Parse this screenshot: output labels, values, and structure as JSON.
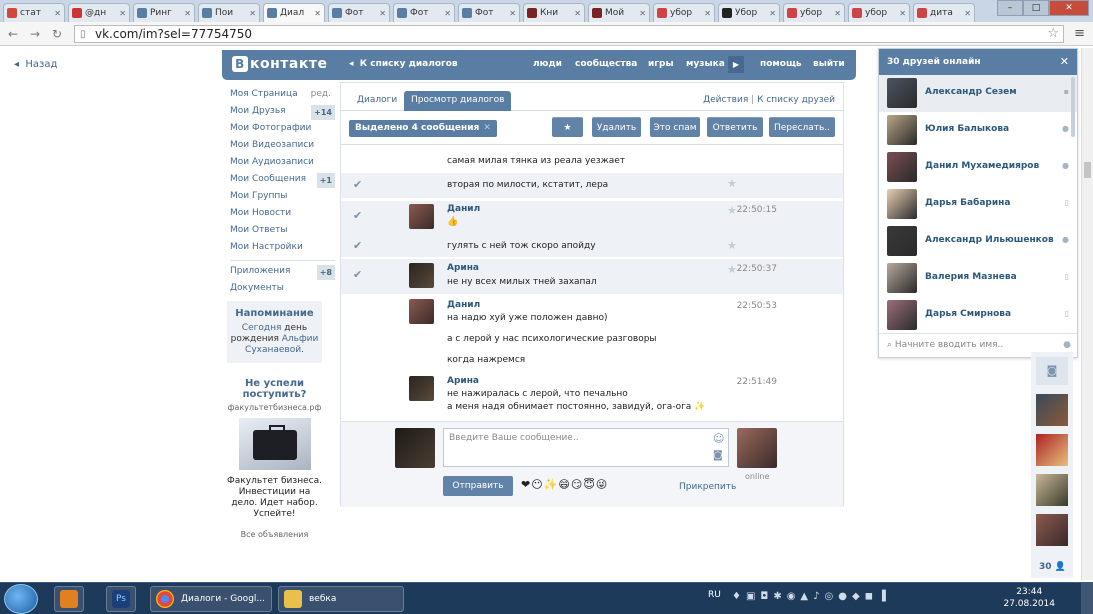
{
  "browser": {
    "tabs": [
      {
        "title": "стат",
        "icon_color": "#d04a3a"
      },
      {
        "title": "@дн",
        "icon_color": "#c33"
      },
      {
        "title": "Ринг",
        "icon_color": "#597da3"
      },
      {
        "title": "Пои",
        "icon_color": "#597da3"
      },
      {
        "title": "Диал",
        "icon_color": "#597da3",
        "active": true
      },
      {
        "title": "Фот",
        "icon_color": "#597da3"
      },
      {
        "title": "Фот",
        "icon_color": "#597da3"
      },
      {
        "title": "Фот",
        "icon_color": "#597da3"
      },
      {
        "title": "Кни",
        "icon_color": "#7a2323"
      },
      {
        "title": "Мой",
        "icon_color": "#7a2323"
      },
      {
        "title": "убор",
        "icon_color": "#c44"
      },
      {
        "title": "Убор",
        "icon_color": "#222"
      },
      {
        "title": "убор",
        "icon_color": "#c44"
      },
      {
        "title": "убор",
        "icon_color": "#c44"
      },
      {
        "title": "дита",
        "icon_color": "#c44"
      }
    ],
    "url": "vk.com/im?sel=77754750"
  },
  "back_label": "Назад",
  "header": {
    "logo": "контакте",
    "logo_letter": "В",
    "to_list": "К списку диалогов",
    "nav": [
      "люди",
      "сообщества",
      "игры",
      "музыка",
      "помощь",
      "выйти"
    ]
  },
  "left_menu": {
    "items": [
      {
        "label": "Моя Страница",
        "extra": "ред."
      },
      {
        "label": "Мои Друзья",
        "badge": "+14"
      },
      {
        "label": "Мои Фотографии"
      },
      {
        "label": "Мои Видеозаписи"
      },
      {
        "label": "Мои Аудиозаписи"
      },
      {
        "label": "Мои Сообщения",
        "badge": "+1"
      },
      {
        "label": "Мои Группы"
      },
      {
        "label": "Мои Новости"
      },
      {
        "label": "Мои Ответы"
      },
      {
        "label": "Мои Настройки"
      }
    ],
    "items2": [
      {
        "label": "Приложения",
        "badge": "+8"
      },
      {
        "label": "Документы"
      }
    ]
  },
  "reminder": {
    "title": "Напоминание",
    "text1": "Сегодня",
    "text2": "день рождения",
    "name": "Альфии Суханаевой",
    "dot": "."
  },
  "ad": {
    "title": "Не успели поступить?",
    "domain": "факультетбизнеса.рф",
    "text": "Факультет бизнеса. Инвестиции на дело. Идет набор. Успейте!",
    "all": "Все объявления"
  },
  "dialog": {
    "tabs": [
      "Диалоги",
      "Просмотр диалогов"
    ],
    "right_actions": "Действия",
    "right_sep": "|",
    "right_list": "К списку друзей",
    "selected": "Выделено 4 сообщения",
    "buttons": [
      "★",
      "Удалить",
      "Это спам",
      "Ответить",
      "Переслать.."
    ],
    "messages": [
      {
        "text": "самая милая тянка из реала уезжает"
      },
      {
        "text": "вторая по милости, кстатит, лера"
      },
      {
        "name": "Данил",
        "time": "22:50:15",
        "text": "👍"
      },
      {
        "text": "гулять с ней тож скоро апойду"
      },
      {
        "name": "Арина",
        "time": "22:50:37",
        "text": "не ну всех милых тней захапал"
      },
      {
        "name": "Данил",
        "time": "22:50:53",
        "text": "на надю хуй уже положен давно)"
      },
      {
        "text": "а с лерой у нас психологические разговоры"
      },
      {
        "text": "когда нажремся"
      },
      {
        "name": "Арина",
        "time": "22:51:49",
        "text": "не нажиралась с лерой, что печально"
      },
      {
        "text": "а меня надя обнимает постоянно, завидуй, ога-ога ✨"
      }
    ],
    "input_placeholder": "Введите Ваше сообщение..",
    "send": "Отправить",
    "emoji": "❤😶✨😄😏😇😜",
    "attach": "Прикрепить",
    "online": "online"
  },
  "friends": {
    "title": "30 друзей онлайн",
    "list": [
      {
        "name": "Александр Сезем",
        "status": "msg",
        "color": "#4a5563"
      },
      {
        "name": "Юлия Балыкова",
        "status": "dot",
        "color": "#b8a688"
      },
      {
        "name": "Данил Мухамедияров",
        "status": "dot",
        "color": "#7a4e52"
      },
      {
        "name": "Дарья Бабарина",
        "status": "mobile",
        "color": "#e8cfb4"
      },
      {
        "name": "Александр Ильюшенков",
        "status": "dot",
        "color": "#3a3a3a"
      },
      {
        "name": "Валерия Мазнева",
        "status": "mobile",
        "color": "#b7a89b"
      },
      {
        "name": "Дарья Смирнова",
        "status": "mobile",
        "color": "#9c6f7c"
      }
    ],
    "search_placeholder": "Начните вводить имя..",
    "count": "30"
  },
  "taskbar": {
    "chrome_window": "Диалоги - Googl...",
    "folder_window": "вебка",
    "lang": "RU",
    "time": "23:44",
    "date": "27.08.2014"
  }
}
